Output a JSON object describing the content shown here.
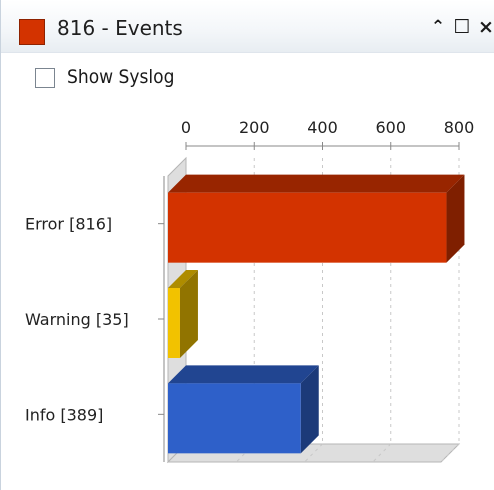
{
  "window": {
    "title": "816 - Events",
    "title_color": "#d33300",
    "controls": {
      "collapse": "⌃",
      "maximize": "☐",
      "close": "×"
    }
  },
  "options": {
    "show_syslog_label": "Show Syslog",
    "show_syslog_checked": false
  },
  "chart_data": {
    "type": "bar",
    "orientation": "horizontal",
    "categories": [
      "Error [816]",
      "Warning [35]",
      "Info [389]"
    ],
    "values": [
      816,
      35,
      389
    ],
    "colors": [
      "#d33300",
      "#f2c200",
      "#2e60c9"
    ],
    "xlim": [
      0,
      800
    ],
    "x_ticks": [
      0,
      200,
      400,
      600,
      800
    ],
    "x_tick_labels": [
      "0",
      "200",
      "400",
      "600",
      "800"
    ],
    "axis_position": "top",
    "grid": true,
    "title": "",
    "xlabel": "",
    "ylabel": ""
  }
}
